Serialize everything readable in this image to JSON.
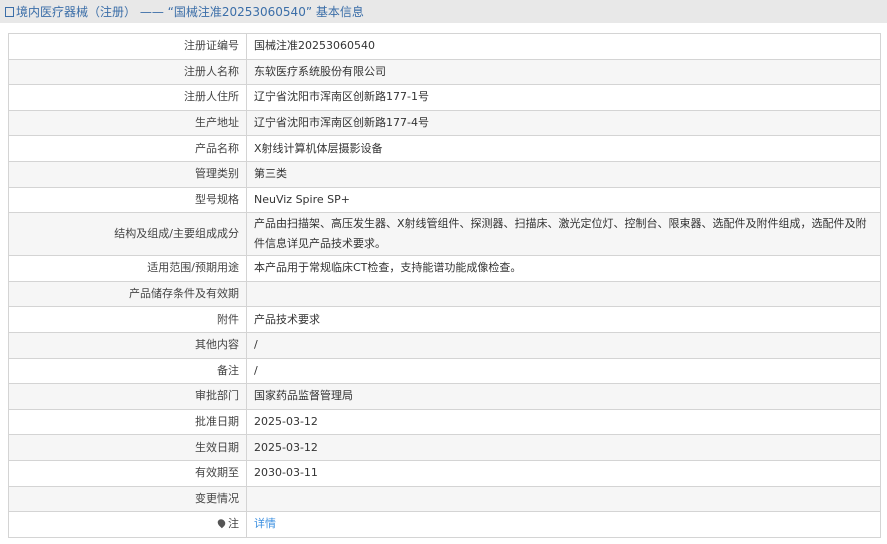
{
  "header": {
    "title": "境内医疗器械（注册） —— “国械注准20253060540” 基本信息"
  },
  "rows": [
    {
      "label": "注册证编号",
      "value": "国械注准20253060540"
    },
    {
      "label": "注册人名称",
      "value": "东软医疗系统股份有限公司"
    },
    {
      "label": "注册人住所",
      "value": "辽宁省沈阳市浑南区创新路177-1号"
    },
    {
      "label": "生产地址",
      "value": "辽宁省沈阳市浑南区创新路177-4号"
    },
    {
      "label": "产品名称",
      "value": "X射线计算机体层摄影设备"
    },
    {
      "label": "管理类别",
      "value": "第三类"
    },
    {
      "label": "型号规格",
      "value": "NeuViz Spire SP+"
    },
    {
      "label": "结构及组成/主要组成成分",
      "value": "产品由扫描架、高压发生器、X射线管组件、探测器、扫描床、激光定位灯、控制台、限束器、选配件及附件组成，选配件及附件信息详见产品技术要求。"
    },
    {
      "label": "适用范围/预期用途",
      "value": "本产品用于常规临床CT检查，支持能谱功能成像检查。"
    },
    {
      "label": "产品储存条件及有效期",
      "value": ""
    },
    {
      "label": "附件",
      "value": "产品技术要求"
    },
    {
      "label": "其他内容",
      "value": "/"
    },
    {
      "label": "备注",
      "value": "/"
    },
    {
      "label": "审批部门",
      "value": "国家药品监督管理局"
    },
    {
      "label": "批准日期",
      "value": "2025-03-12"
    },
    {
      "label": "生效日期",
      "value": "2025-03-12"
    },
    {
      "label": "有效期至",
      "value": "2030-03-11"
    },
    {
      "label": "变更情况",
      "value": ""
    },
    {
      "label": "注",
      "value": "详情"
    }
  ]
}
